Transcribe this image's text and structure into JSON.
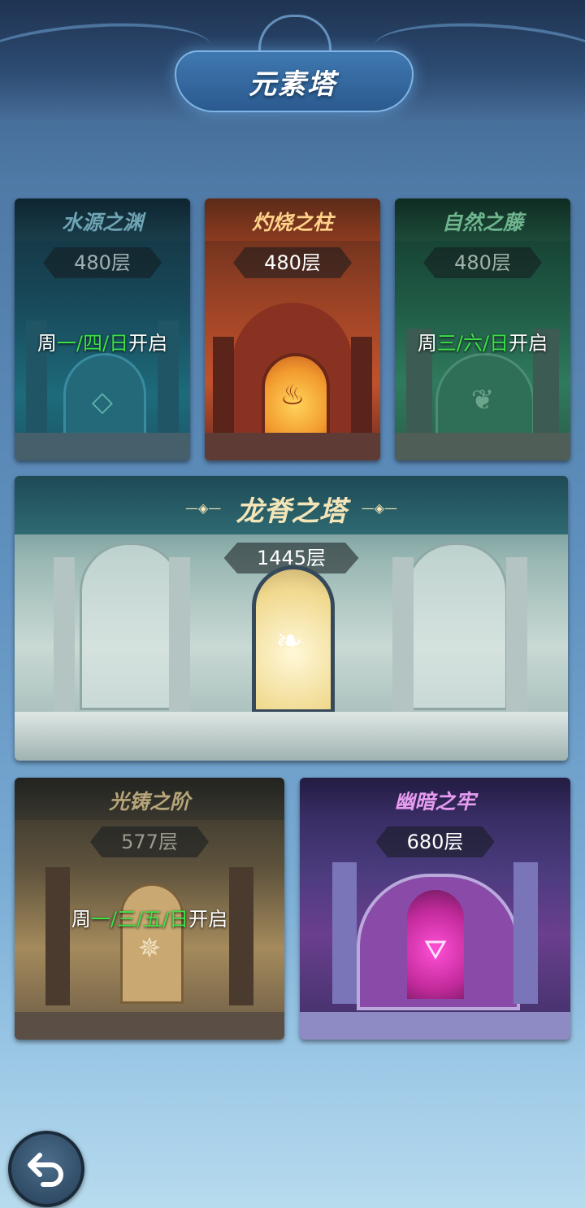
{
  "header": {
    "title": "元素塔"
  },
  "towers": {
    "water": {
      "name": "水源之渊",
      "floors": "480层",
      "schedule": {
        "prefix": "周",
        "days": [
          "一",
          "四",
          "日"
        ],
        "suffix": "开启"
      }
    },
    "fire": {
      "name": "灼烧之柱",
      "floors": "480层"
    },
    "nature": {
      "name": "自然之藤",
      "floors": "480层",
      "schedule": {
        "prefix": "周",
        "days": [
          "三",
          "六",
          "日"
        ],
        "suffix": "开启"
      }
    },
    "dragon": {
      "name": "龙脊之塔",
      "floors": "1445层"
    },
    "light": {
      "name": "光铸之阶",
      "floors": "577层",
      "schedule": {
        "prefix": "周",
        "days": [
          "一",
          "三",
          "五",
          "日"
        ],
        "suffix": "开启"
      }
    },
    "dark": {
      "name": "幽暗之牢",
      "floors": "680层"
    }
  },
  "separator": "/",
  "colors": {
    "schedule_day": "#3de246",
    "water_title": "#6ea4b4",
    "fire_title": "#ffd38a",
    "nature_title": "#6fb58e",
    "dragon_title": "#f3e5b8",
    "light_title": "#b7a57a",
    "dark_title": "#e79cf0"
  },
  "icons": {
    "back": "back-arrow-icon"
  }
}
